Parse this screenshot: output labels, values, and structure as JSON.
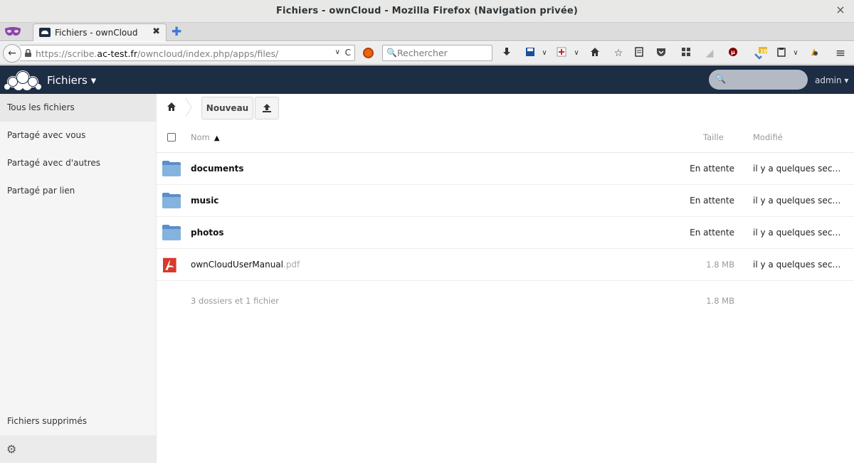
{
  "window": {
    "title": "Fichiers - ownCloud - Mozilla Firefox (Navigation privée)",
    "close_glyph": "×"
  },
  "browser": {
    "tab": {
      "label": "Fichiers - ownCloud",
      "close_glyph": "✖"
    },
    "new_tab_glyph": "✚",
    "back_glyph": "←",
    "url": {
      "prefix": "https://scribe.",
      "domain": "ac-test.fr",
      "path": "/owncloud/index.php/apps/files/"
    },
    "url_dropdown_glyph": "∨",
    "reload_glyph": "C",
    "search": {
      "placeholder": "Rechercher",
      "icon_glyph": "🔍"
    },
    "badge_count": "10",
    "menu_glyph": "≡"
  },
  "owncloud": {
    "app_label": "Fichiers ▾",
    "user_label": "admin ▾",
    "search_icon_glyph": "🔍"
  },
  "sidebar": {
    "items": [
      {
        "label": "Tous les fichiers",
        "active": true
      },
      {
        "label": "Partagé avec vous",
        "active": false
      },
      {
        "label": "Partagé avec d'autres",
        "active": false
      },
      {
        "label": "Partagé par lien",
        "active": false
      }
    ],
    "deleted_label": "Fichiers supprimés",
    "settings_glyph": "⚙"
  },
  "controls": {
    "new_label": "Nouveau"
  },
  "file_list": {
    "columns": {
      "name": "Nom",
      "sort_arrow": "▲",
      "size": "Taille",
      "modified": "Modifié"
    },
    "rows": [
      {
        "name": "documents",
        "ext": "",
        "type": "folder",
        "size": "En attente",
        "modified": "il y a quelques secon…"
      },
      {
        "name": "music",
        "ext": "",
        "type": "folder",
        "size": "En attente",
        "modified": "il y a quelques secon…"
      },
      {
        "name": "photos",
        "ext": "",
        "type": "folder",
        "size": "En attente",
        "modified": "il y a quelques secon…"
      },
      {
        "name": "ownCloudUserManual",
        "ext": ".pdf",
        "type": "pdf",
        "size": "1.8 MB",
        "modified": "il y a quelques secon…"
      }
    ],
    "summary": {
      "text": "3 dossiers et 1 fichier",
      "size": "1.8 MB"
    }
  },
  "colors": {
    "header_bg": "#1d2d44",
    "pdf_red": "#d8392b",
    "folder_blue": "#76a8d8"
  }
}
